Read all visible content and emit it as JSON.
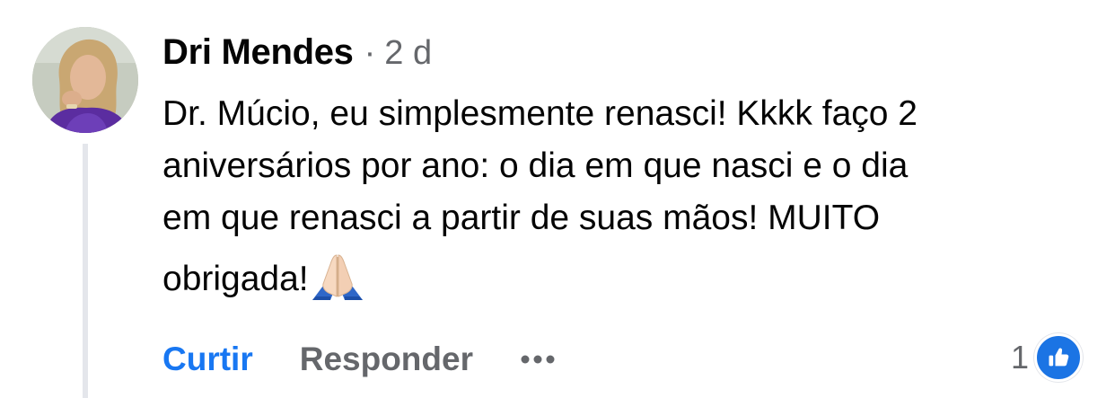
{
  "comment": {
    "author": "Dri Mendes",
    "separator": "·",
    "time": "2 d",
    "text_lines": [
      "Dr. Múcio,  eu simplesmente renasci! Kkkk faço 2",
      "aniversários por ano: o dia em que nasci e o dia",
      "em que renasci a partir de suas mãos! MUITO",
      "obrigada!"
    ],
    "emoji": "pray-emoji"
  },
  "actions": {
    "like_label": "Curtir",
    "reply_label": "Responder",
    "more_icon": "more-dots-icon"
  },
  "reactions": {
    "count": "1",
    "icon": "like-thumb-icon"
  },
  "colors": {
    "accent": "#1877f2",
    "secondary_text": "#65676b",
    "primary_text": "#050505",
    "thread_line": "#e4e6eb"
  }
}
